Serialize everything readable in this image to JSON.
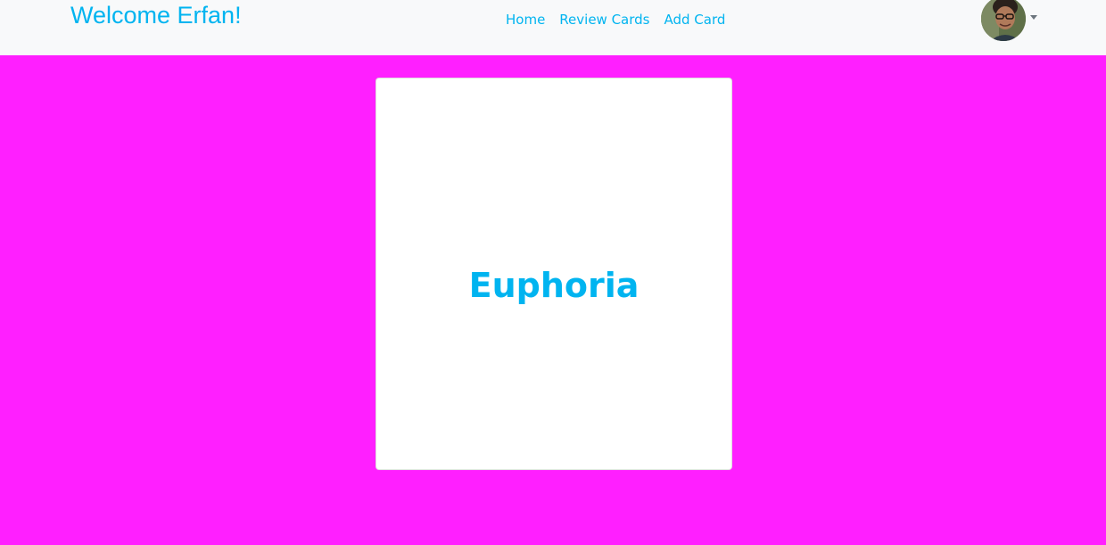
{
  "navbar": {
    "brand": "Welcome Erfan!",
    "links": [
      {
        "label": "Home"
      },
      {
        "label": "Review Cards"
      },
      {
        "label": "Add Card"
      }
    ],
    "profile": {
      "avatar_alt": "Erfan profile photo"
    }
  },
  "card": {
    "word": "Euphoria"
  },
  "colors": {
    "accent": "#00b4f0",
    "page_background": "#ff1fff",
    "navbar_background": "#f8f9fa",
    "card_background": "#ffffff"
  }
}
